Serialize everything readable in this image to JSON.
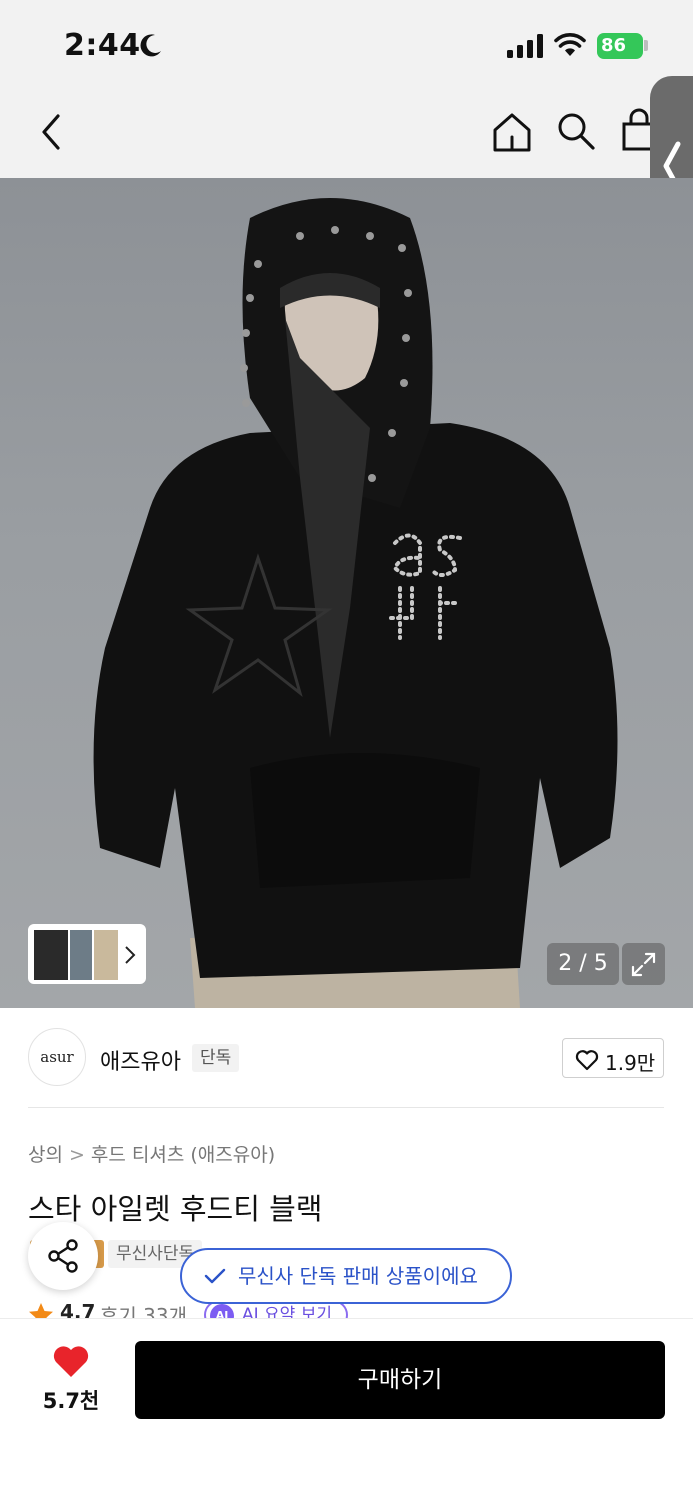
{
  "status_bar": {
    "time": "2:44",
    "battery": "86"
  },
  "gallery": {
    "pager": "2 / 5",
    "current": 2,
    "total": 5
  },
  "brand": {
    "logo_text": "asur",
    "name": "애즈유아",
    "badge": "단독",
    "likes": "1.9만"
  },
  "breadcrumb": {
    "category": "상의",
    "separator": ">",
    "subcategory": "후드 티셔츠 (애즈유아)"
  },
  "product": {
    "title": "스타 아일렛 후드티 블랙",
    "tag": "무신사단독",
    "rating": "4.7",
    "reviews": "후기 33개",
    "ai_badge": "AI",
    "ai_summary": "AI 요약 보기"
  },
  "toast": {
    "message": "무신사 단독 판매 상품이에요"
  },
  "bottom_bar": {
    "wish_count": "5.7천",
    "buy_label": "구매하기"
  },
  "colors": {
    "accent_blue": "#3b63d6",
    "heart_red": "#e8242b",
    "buy_black": "#000000",
    "ai_purple": "#7c5cf2"
  },
  "icons": [
    "moon-icon",
    "signal-icon",
    "wifi-icon",
    "back-icon",
    "home-icon",
    "search-icon",
    "bag-icon",
    "chevron-left-icon",
    "chevron-right-icon",
    "expand-icon",
    "heart-outline-icon",
    "share-icon",
    "check-icon",
    "star-icon",
    "heart-filled-icon"
  ]
}
